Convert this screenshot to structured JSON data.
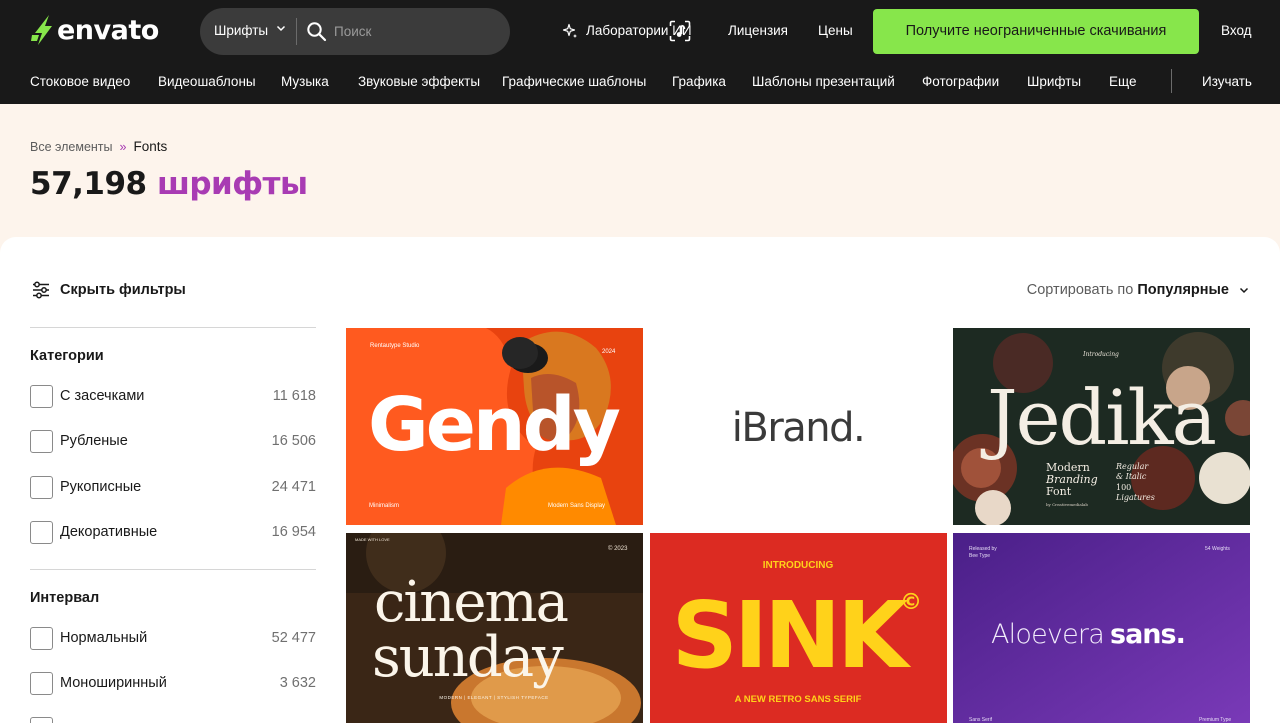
{
  "brand": {
    "name": "envato",
    "accent": "#87e64b",
    "purple": "#a83bb3"
  },
  "search": {
    "category": "Шрифты",
    "placeholder": "Поиск"
  },
  "top_nav": {
    "ai_labs": "Лаборатории ИИ",
    "license": "Лицензия",
    "prices": "Цены",
    "cta": "Получите неограниченные скачивания",
    "login": "Вход"
  },
  "categories_nav": {
    "items": [
      "Стоковое видео",
      "Видеошаблоны",
      "Музыка",
      "Звуковые эффекты",
      "Графические шаблоны",
      "Графика",
      "Шаблоны презентаций",
      "Фотографии",
      "Шрифты",
      "Еще"
    ],
    "learn": "Изучать"
  },
  "breadcrumb": {
    "root": "Все элементы",
    "separator": "»",
    "current": "Fonts"
  },
  "page": {
    "count": "57,198",
    "title_word": "шрифты"
  },
  "filters": {
    "toggle_label": "Скрыть фильтры",
    "sort_prefix": "Сортировать по",
    "sort_value": "Популярные",
    "groups": [
      {
        "title": "Категории",
        "options": [
          {
            "label": "С засечками",
            "count": "11 618",
            "checked": false
          },
          {
            "label": "Рубленые",
            "count": "16 506",
            "checked": false
          },
          {
            "label": "Рукописные",
            "count": "24 471",
            "checked": false
          },
          {
            "label": "Декоративные",
            "count": "16 954",
            "checked": false
          }
        ]
      },
      {
        "title": "Интервал",
        "options": [
          {
            "label": "Нормальный",
            "count": "52 477",
            "checked": false
          },
          {
            "label": "Моноширинный",
            "count": "3 632",
            "checked": false
          }
        ]
      }
    ]
  },
  "results": [
    {
      "title": "Gendy",
      "studio": "Rentautype Studio",
      "year": "2024",
      "tag_left": "Minimalism",
      "tag_right": "Modern Sans Display",
      "bg": "#ff5a1f"
    },
    {
      "title": "iBrand.",
      "bg": "#ffffff"
    },
    {
      "title": "Jedika",
      "overline": "Introducing",
      "line1": "Modern",
      "line2": "Branding",
      "line3": "Font",
      "side1": "Regular",
      "side2": "& Italic",
      "side3": "100",
      "side4": "Ligatures",
      "byline": "by Creativemedialab",
      "bg": "#1d2a22"
    },
    {
      "title_line1": "cinema",
      "title_line2": "sunday",
      "overline": "MADE WITH LOVE",
      "year": "© 2023",
      "tagline": "MODERN | ELEGANT | STYLISH TYPEFACE",
      "bg": "#3a2616"
    },
    {
      "title": "SINK",
      "overline": "INTRODUCING",
      "symbol": "©",
      "tagline": "A NEW RETRO SANS SERIF",
      "bg": "#dc2b22",
      "accent": "#ffd21a"
    },
    {
      "title_light": "Aloevera",
      "title_bold": "sans.",
      "released_by": "Released by",
      "studio": "Bee Type",
      "weights": "54 Weights",
      "tag_left": "Sans Serif",
      "tag_right": "Premium Type",
      "bg": "#5b2a9e"
    }
  ]
}
